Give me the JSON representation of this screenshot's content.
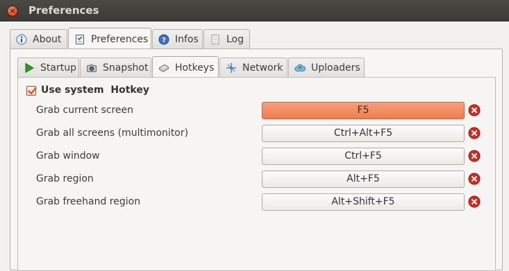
{
  "window": {
    "title": "Preferences",
    "close_glyph": "×"
  },
  "top_tabs": [
    {
      "label": "About",
      "icon": "info-icon"
    },
    {
      "label": "Preferences",
      "icon": "preferences-icon",
      "active": true
    },
    {
      "label": "Infos",
      "icon": "help-icon"
    },
    {
      "label": "Log",
      "icon": "log-icon"
    }
  ],
  "sub_tabs": [
    {
      "label": "Startup",
      "icon": "play-icon"
    },
    {
      "label": "Snapshot",
      "icon": "camera-icon"
    },
    {
      "label": "Hotkeys",
      "icon": "keyboard-icon",
      "active": true
    },
    {
      "label": "Network",
      "icon": "network-icon"
    },
    {
      "label": "Uploaders",
      "icon": "cloud-icon"
    }
  ],
  "hotkeys": {
    "use_system_hotkey": {
      "label": "Use system  Hotkey",
      "checked": true
    },
    "rows": [
      {
        "label": "Grab current screen",
        "key": "F5",
        "active": true
      },
      {
        "label": "Grab all screens (multimonitor)",
        "key": "Ctrl+Alt+F5"
      },
      {
        "label": "Grab window",
        "key": "Ctrl+F5"
      },
      {
        "label": "Grab region",
        "key": "Alt+F5"
      },
      {
        "label": "Grab freehand region",
        "key": "Alt+Shift+F5"
      }
    ]
  },
  "colors": {
    "accent": "#ee7c4e",
    "titlebar": "#3c3b37",
    "clear_red": "#d62a1e"
  }
}
